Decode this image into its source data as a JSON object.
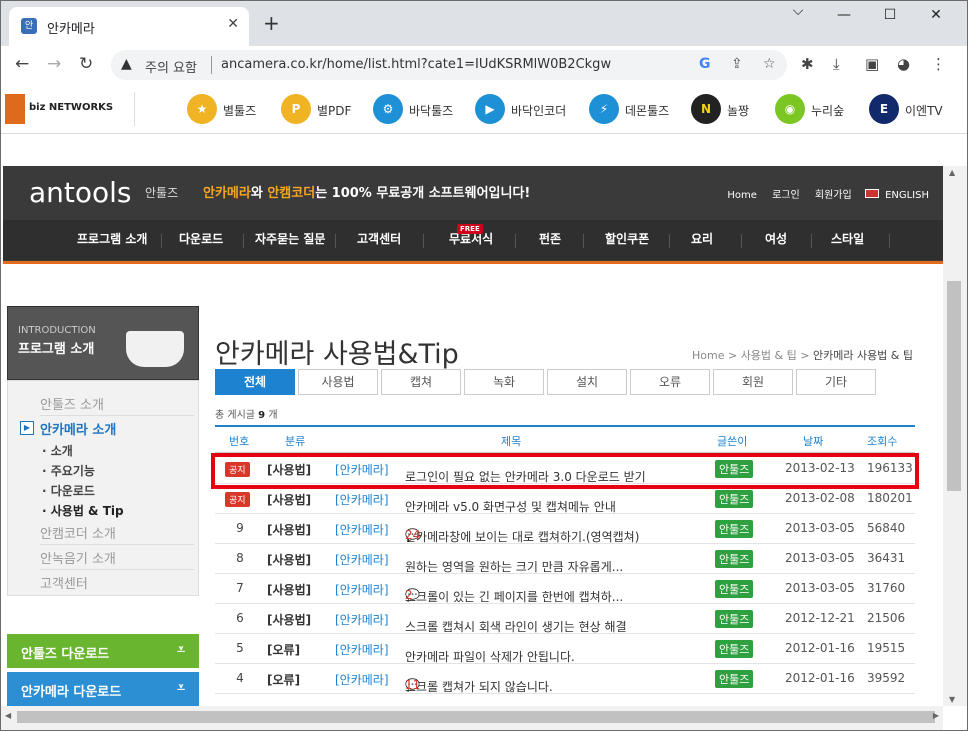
{
  "browser": {
    "tab_title": "안카메라",
    "tab_favicon": "안",
    "url_security": "주의 요함",
    "url": "ancamera.co.kr/home/list.html?cate1=IUdKSRMlW0B2Ckgw",
    "minimize": "⌵",
    "new_tab": "+",
    "back": "←",
    "forward": "→",
    "reload": "↻"
  },
  "bookmarks": {
    "biz_logo": "biz NETWORKS",
    "items": [
      {
        "label": "별툴즈",
        "color": "#f0b323",
        "icon": "★"
      },
      {
        "label": "별PDF",
        "color": "#f0b323",
        "icon": "P"
      },
      {
        "label": "바닥툴즈",
        "color": "#1e90d6",
        "icon": "⚙"
      },
      {
        "label": "바닥인코더",
        "color": "#1e90d6",
        "icon": "▶"
      },
      {
        "label": "데몬툴즈",
        "color": "#1e90d6",
        "icon": "⚡"
      },
      {
        "label": "놀짱",
        "color": "#222222",
        "icon": "N"
      },
      {
        "label": "누리숲",
        "color": "#7cc623",
        "icon": "◉"
      },
      {
        "label": "이엔TV",
        "color": "#122a6b",
        "icon": "E"
      }
    ]
  },
  "header": {
    "brand": "antools",
    "brand_sub": "안툴즈",
    "slogan_a": "안카메라",
    "slogan_b": "와 ",
    "slogan_c": "안캠코더",
    "slogan_d": "는 100% 무료공개 소프트웨어입니다!",
    "toplinks": [
      "Home",
      "로그인",
      "회원가입",
      "ENGLISH"
    ],
    "gnb": [
      "프로그램 소개",
      "다운로드",
      "자주묻는 질문",
      "고객센터",
      "무료서식",
      "펀존",
      "할인쿠폰",
      "요리",
      "여성",
      "스타일"
    ],
    "free_badge": "FREE"
  },
  "sidebar": {
    "intro_en": "INTRODUCTION",
    "intro_ko": "프로그램 소개",
    "menu": [
      {
        "label": "안툴즈 소개",
        "active": false
      },
      {
        "label": "안카메라 소개",
        "active": true
      },
      {
        "label": "안캠코더 소개",
        "active": false
      },
      {
        "label": "안녹음기 소개",
        "active": false
      },
      {
        "label": "고객센터",
        "active": false
      }
    ],
    "sub": [
      "소개",
      "주요기능",
      "다운로드",
      "사용법 & Tip"
    ],
    "downloads": [
      {
        "label": "안툴즈 다운로드",
        "color": "#6ab530"
      },
      {
        "label": "안카메라 다운로드",
        "color": "#2c8fd3"
      }
    ]
  },
  "content": {
    "title": "안카메라 사용법&Tip",
    "breadcrumb": [
      "Home",
      "사용법 & 팁",
      "안카메라 사용법 & 팁"
    ],
    "tabs": [
      "전체",
      "사용법",
      "캡쳐",
      "녹화",
      "설치",
      "오류",
      "회원",
      "기타"
    ],
    "count_label": "총 게시글",
    "count_value": "9",
    "count_unit": "개",
    "columns": [
      "번호",
      "분류",
      "제목",
      "글쓴이",
      "날짜",
      "조회수"
    ],
    "rows": [
      {
        "num": "공지",
        "notice": true,
        "cat": "[사용법]",
        "pfx": "[안카메라]",
        "subj": "로그인이 필요 없는 안카메라 3.0 다운로드 받기",
        "comments": "",
        "author": "안툴즈",
        "date": "2013-02-13",
        "views": "196133"
      },
      {
        "num": "공지",
        "notice": true,
        "cat": "[사용법]",
        "pfx": "[안카메라]",
        "subj": "안카메라 v5.0 화면구성 및 캡쳐메뉴 안내",
        "comments": "",
        "author": "안툴즈",
        "date": "2013-02-08",
        "views": "180201"
      },
      {
        "num": "9",
        "notice": false,
        "cat": "[사용법]",
        "pfx": "[안카메라]",
        "subj": "안카메라창에 보이는 대로 캡쳐하기.(영역캡쳐)",
        "comments": "24",
        "author": "안툴즈",
        "date": "2013-03-05",
        "views": "56840"
      },
      {
        "num": "8",
        "notice": false,
        "cat": "[사용법]",
        "pfx": "[안카메라]",
        "subj": "원하는 영역을 원하는 크기 만큼 자유롭게...",
        "comments": "",
        "author": "안툴즈",
        "date": "2013-03-05",
        "views": "36431"
      },
      {
        "num": "7",
        "notice": false,
        "cat": "[사용법]",
        "pfx": "[안카메라]",
        "subj": "스크롤이 있는 긴 페이지를 한번에 캡쳐하...",
        "comments": "2",
        "author": "안툴즈",
        "date": "2013-03-05",
        "views": "31760"
      },
      {
        "num": "6",
        "notice": false,
        "cat": "[사용법]",
        "pfx": "[안카메라]",
        "subj": "스크롤 캡쳐시 회색 라인이 생기는 현상 해결",
        "comments": "",
        "author": "안툴즈",
        "date": "2012-12-21",
        "views": "21506"
      },
      {
        "num": "5",
        "notice": false,
        "cat": "[오류]",
        "pfx": "[안카메라]",
        "subj": "안카메라 파일이 삭제가 안됩니다.",
        "comments": "",
        "author": "안툴즈",
        "date": "2012-01-16",
        "views": "19515"
      },
      {
        "num": "4",
        "notice": false,
        "cat": "[오류]",
        "pfx": "[안카메라]",
        "subj": "스크롤 캡쳐가 되지 않습니다.",
        "comments": "11",
        "author": "안툴즈",
        "date": "2012-01-16",
        "views": "39592"
      }
    ]
  }
}
